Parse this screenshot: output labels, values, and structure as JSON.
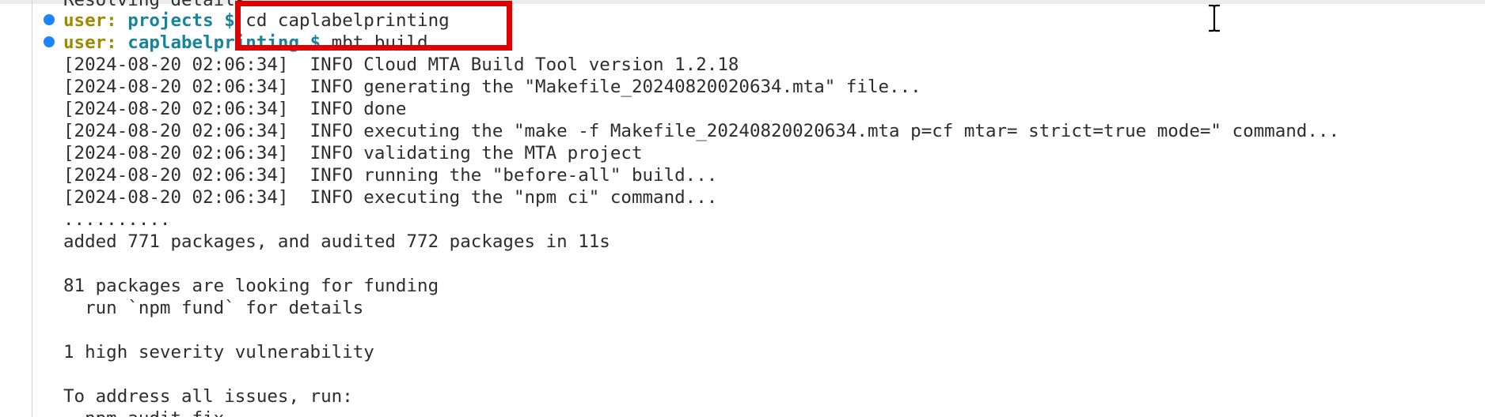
{
  "terminal": {
    "truncated_line": "Resolving details...",
    "prompts": [
      {
        "user": "user:",
        "dir": "projects",
        "symbol": "$",
        "command": "cd caplabelprinting"
      },
      {
        "user": "user:",
        "dir": "caplabelprinting",
        "symbol": "$",
        "command": "mbt build"
      }
    ],
    "output": [
      "[2024-08-20 02:06:34]  INFO Cloud MTA Build Tool version 1.2.18",
      "[2024-08-20 02:06:34]  INFO generating the \"Makefile_20240820020634.mta\" file...",
      "[2024-08-20 02:06:34]  INFO done",
      "[2024-08-20 02:06:34]  INFO executing the \"make -f Makefile_20240820020634.mta p=cf mtar= strict=true mode=\" command...",
      "[2024-08-20 02:06:34]  INFO validating the MTA project",
      "[2024-08-20 02:06:34]  INFO running the \"before-all\" build...",
      "[2024-08-20 02:06:34]  INFO executing the \"npm ci\" command...",
      "..........",
      "added 771 packages, and audited 772 packages in 11s",
      "",
      "81 packages are looking for funding",
      "  run `npm fund` for details",
      "",
      "1 high severity vulnerability",
      "",
      "To address all issues, run:",
      "  npm audit fix"
    ]
  },
  "colors": {
    "user": "#9c8a00",
    "dir": "#16849b",
    "dot": "#1a85ff",
    "highlight": "#e00000"
  },
  "icons": {
    "cursor": "ibeam-cursor-icon",
    "decoration": "circle-dot-icon"
  }
}
